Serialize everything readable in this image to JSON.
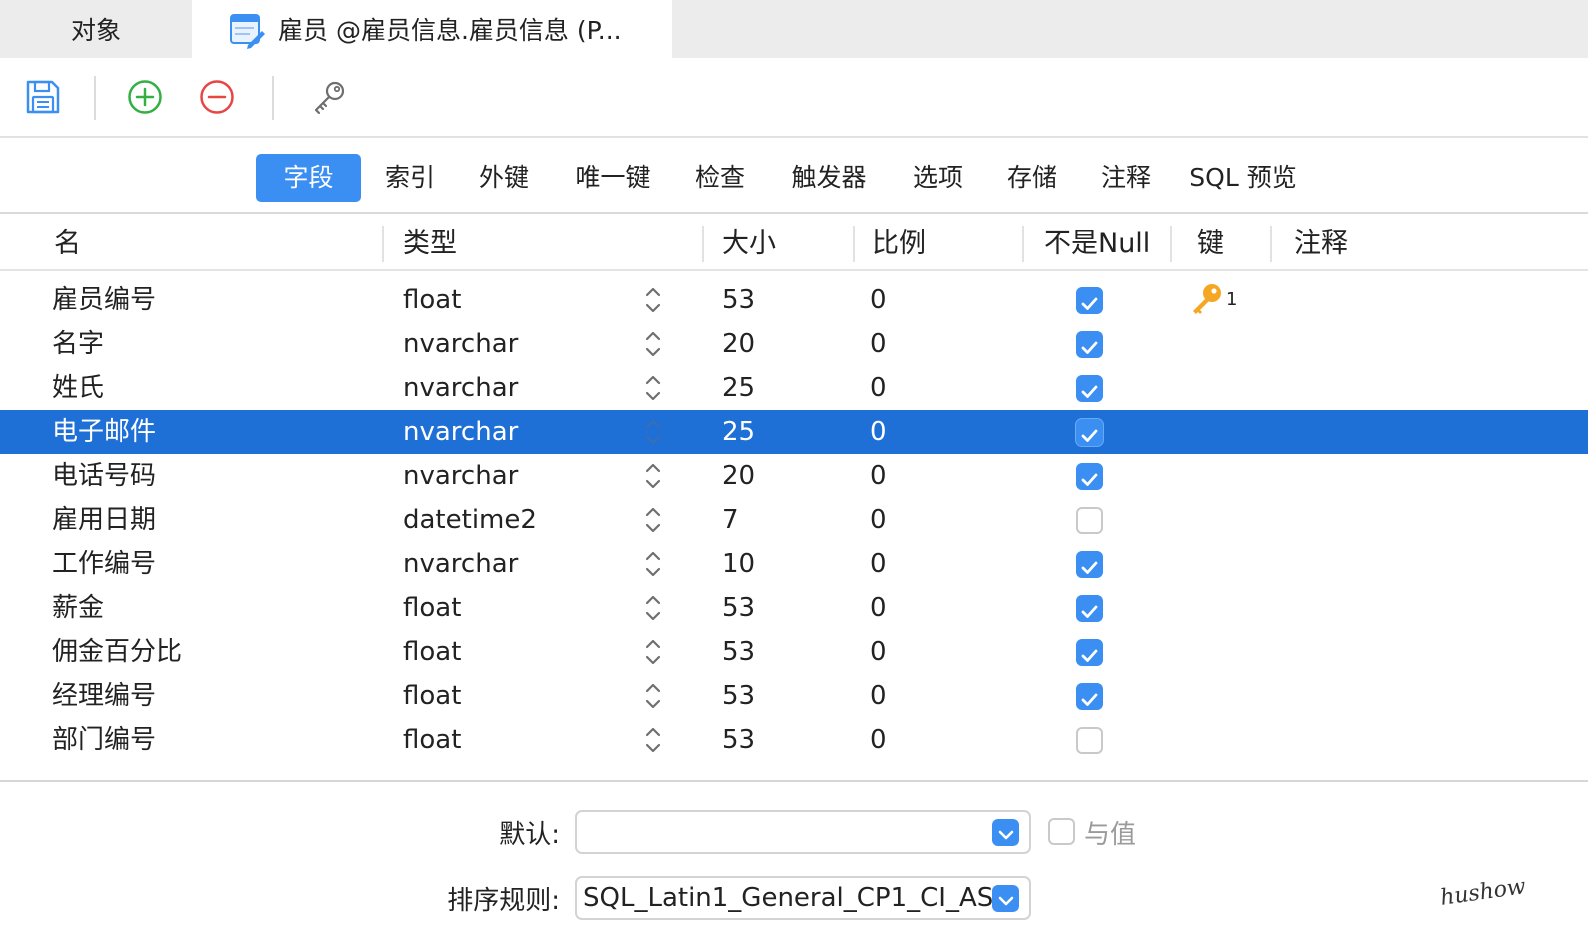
{
  "tabs": {
    "objects_label": "对象",
    "active_title": "雇员 @雇员信息.雇员信息 (P..."
  },
  "toolbar": {
    "icons": [
      "save-icon",
      "add-field-icon",
      "delete-field-icon",
      "primary-key-icon"
    ]
  },
  "subtabs": [
    "字段",
    "索引",
    "外键",
    "唯一键",
    "检查",
    "触发器",
    "选项",
    "存储",
    "注释",
    "SQL 预览"
  ],
  "active_subtab": "字段",
  "columns": [
    "名",
    "类型",
    "大小",
    "比例",
    "不是Null",
    "键",
    "注释"
  ],
  "rows": [
    {
      "name": "雇员编号",
      "type": "float",
      "size": "53",
      "scale": "0",
      "not_null": true,
      "key": "1"
    },
    {
      "name": "名字",
      "type": "nvarchar",
      "size": "20",
      "scale": "0",
      "not_null": true,
      "key": ""
    },
    {
      "name": "姓氏",
      "type": "nvarchar",
      "size": "25",
      "scale": "0",
      "not_null": true,
      "key": ""
    },
    {
      "name": "电子邮件",
      "type": "nvarchar",
      "size": "25",
      "scale": "0",
      "not_null": true,
      "key": "",
      "selected": true
    },
    {
      "name": "电话号码",
      "type": "nvarchar",
      "size": "20",
      "scale": "0",
      "not_null": true,
      "key": ""
    },
    {
      "name": "雇用日期",
      "type": "datetime2",
      "size": "7",
      "scale": "0",
      "not_null": false,
      "key": ""
    },
    {
      "name": "工作编号",
      "type": "nvarchar",
      "size": "10",
      "scale": "0",
      "not_null": true,
      "key": ""
    },
    {
      "name": "薪金",
      "type": "float",
      "size": "53",
      "scale": "0",
      "not_null": true,
      "key": ""
    },
    {
      "name": "佣金百分比",
      "type": "float",
      "size": "53",
      "scale": "0",
      "not_null": true,
      "key": ""
    },
    {
      "name": "经理编号",
      "type": "float",
      "size": "53",
      "scale": "0",
      "not_null": true,
      "key": ""
    },
    {
      "name": "部门编号",
      "type": "float",
      "size": "53",
      "scale": "0",
      "not_null": false,
      "key": ""
    }
  ],
  "properties": {
    "default_label": "默认:",
    "default_value": "",
    "collation_label": "排序规则:",
    "collation_value": "SQL_Latin1_General_CP1_CI_AS",
    "with_value_label": "与值",
    "with_value_checked": false
  },
  "watermark": "hushow",
  "colors": {
    "accent": "#3b8ff3",
    "selected_row": "#1e6fd6",
    "key_gold": "#f5a623"
  }
}
